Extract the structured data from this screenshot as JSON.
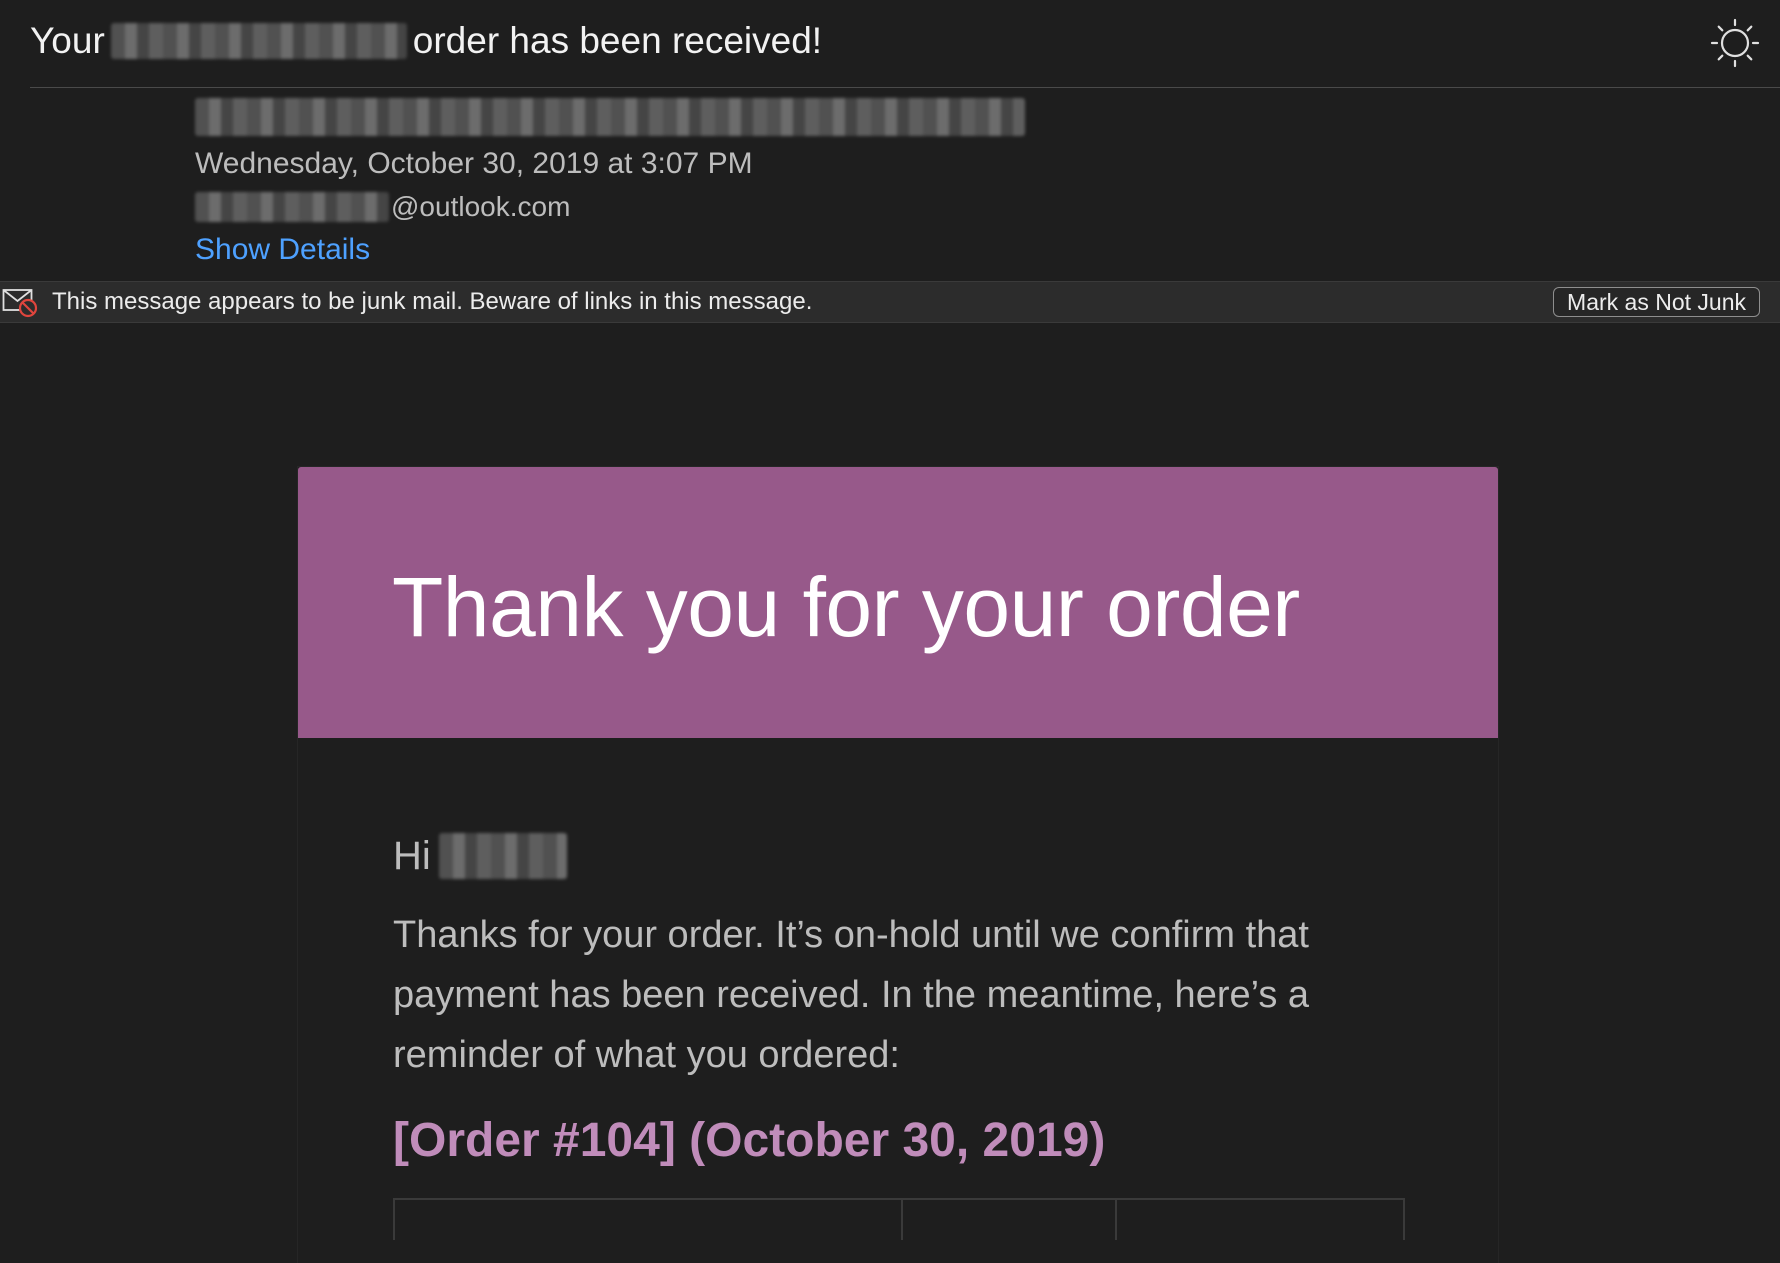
{
  "message": {
    "subject_prefix": "Your",
    "subject_suffix": "order has been received!",
    "date": "Wednesday, October 30, 2019 at 3:07 PM",
    "recipient_domain": "@outlook.com",
    "show_details": "Show Details"
  },
  "junk_banner": {
    "text": "This message appears to be junk mail. Beware of links in this message.",
    "button": "Mark as Not Junk"
  },
  "email": {
    "hero_title": "Thank you for your order",
    "greeting": "Hi",
    "intro": "Thanks for your order. It’s on-hold until we confirm that payment has been received. In the meantime, here’s a reminder of what you ordered:",
    "order_heading": "[Order #104] (October 30, 2019)"
  },
  "icons": {
    "appearance": "sun-icon",
    "junk": "junk-mail-icon"
  },
  "colors": {
    "background": "#1e1e1e",
    "hero": "#97598a",
    "order_heading": "#c08cba",
    "link": "#4ea1ff"
  }
}
